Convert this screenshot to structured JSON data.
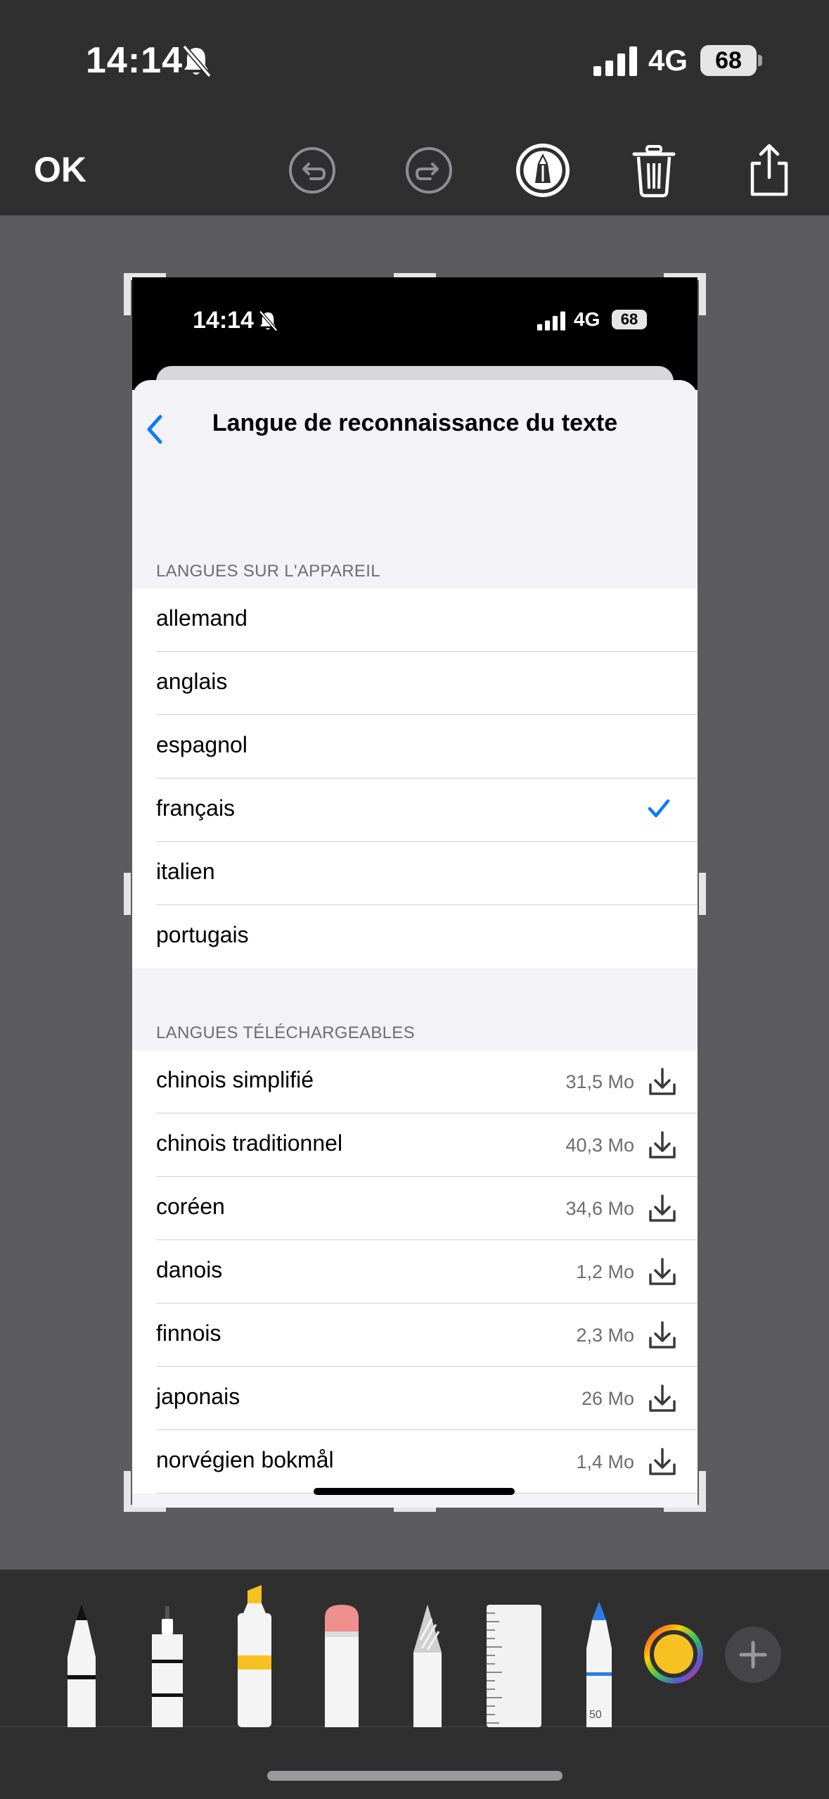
{
  "status_bar": {
    "time": "14:14",
    "network": "4G",
    "battery": "68"
  },
  "toolbar": {
    "done_label": "OK",
    "icons": [
      "undo-icon",
      "redo-icon",
      "markup-pen-icon",
      "trash-icon",
      "share-icon"
    ]
  },
  "screenshot": {
    "status_bar": {
      "time": "14:14",
      "network": "4G",
      "battery": "68"
    },
    "title": "Langue de reconnaissance du texte",
    "device_section": {
      "header": "LANGUES SUR L'APPAREIL",
      "items": [
        {
          "label": "allemand"
        },
        {
          "label": "anglais"
        },
        {
          "label": "espagnol"
        },
        {
          "label": "français",
          "selected": true
        },
        {
          "label": "italien"
        },
        {
          "label": "portugais"
        }
      ]
    },
    "download_section": {
      "header": "LANGUES TÉLÉCHARGEABLES",
      "items": [
        {
          "label": "chinois simplifié",
          "size": "31,5 Mo"
        },
        {
          "label": "chinois traditionnel",
          "size": "40,3 Mo"
        },
        {
          "label": "coréen",
          "size": "34,6 Mo"
        },
        {
          "label": "danois",
          "size": "1,2 Mo"
        },
        {
          "label": "finnois",
          "size": "2,3 Mo"
        },
        {
          "label": "japonais",
          "size": "26 Mo"
        },
        {
          "label": "norvégien bokmål",
          "size": "1,4 Mo"
        }
      ]
    }
  },
  "tools": {
    "items": [
      "pen",
      "monoline",
      "highlighter",
      "eraser",
      "lasso",
      "ruler",
      "pencil"
    ],
    "pencil_width": "50",
    "color": "#f7c221",
    "add_icon": "plus-icon"
  },
  "colors": {
    "accent": "#0a7aff",
    "background": "#5c5c5e",
    "bar": "#2f2f30"
  }
}
